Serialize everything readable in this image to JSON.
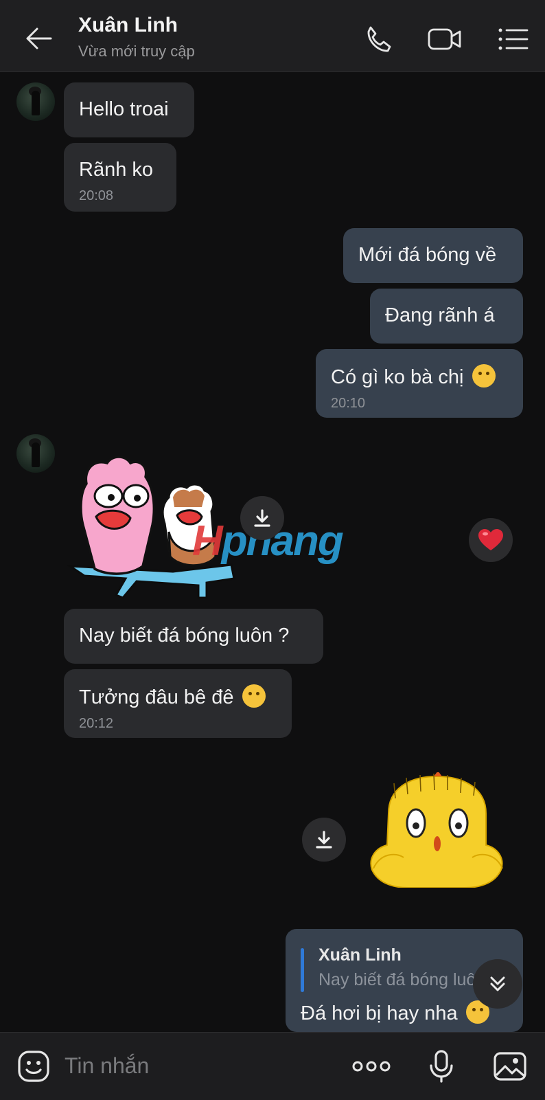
{
  "header": {
    "name": "Xuân Linh",
    "status": "Vừa mới truy cập",
    "icons": [
      "back-arrow-icon",
      "phone-icon",
      "video-call-icon",
      "menu-list-icon"
    ]
  },
  "messages": {
    "m1": {
      "text": "Hello troai"
    },
    "m2": {
      "text": "Rãnh ko",
      "time": "20:08"
    },
    "m3": {
      "text": "Mới đá bóng về"
    },
    "m4": {
      "text": "Đang rãnh á"
    },
    "m5": {
      "text": "Có gì ko bà chị",
      "time": "20:10",
      "emoji": "woozy-face"
    },
    "m6": {
      "text": "Nay biết đá bóng luôn ?"
    },
    "m7": {
      "text": "Tưởng đâu bê đê",
      "time": "20:12",
      "emoji": "laughing-face"
    }
  },
  "reply": {
    "quoted_name": "Xuân Linh",
    "quoted_text": "Nay biết đá bóng luôn ?",
    "text": "Đá hơi bị hay nha",
    "emoji": "hand-over-mouth-face"
  },
  "watermark": {
    "lead": "H",
    "rest": "phang"
  },
  "composer": {
    "placeholder": "Tin nhắn",
    "icons": [
      "sticker-icon",
      "more-dots-icon",
      "microphone-icon",
      "image-icon"
    ]
  },
  "colors": {
    "background": "#0f0f10",
    "header": "#1f1f21",
    "incoming_bubble": "#2a2b2e",
    "outgoing_bubble": "#37414e",
    "reply_bar": "#2f7ad8",
    "reaction_heart": "#e0293a"
  }
}
